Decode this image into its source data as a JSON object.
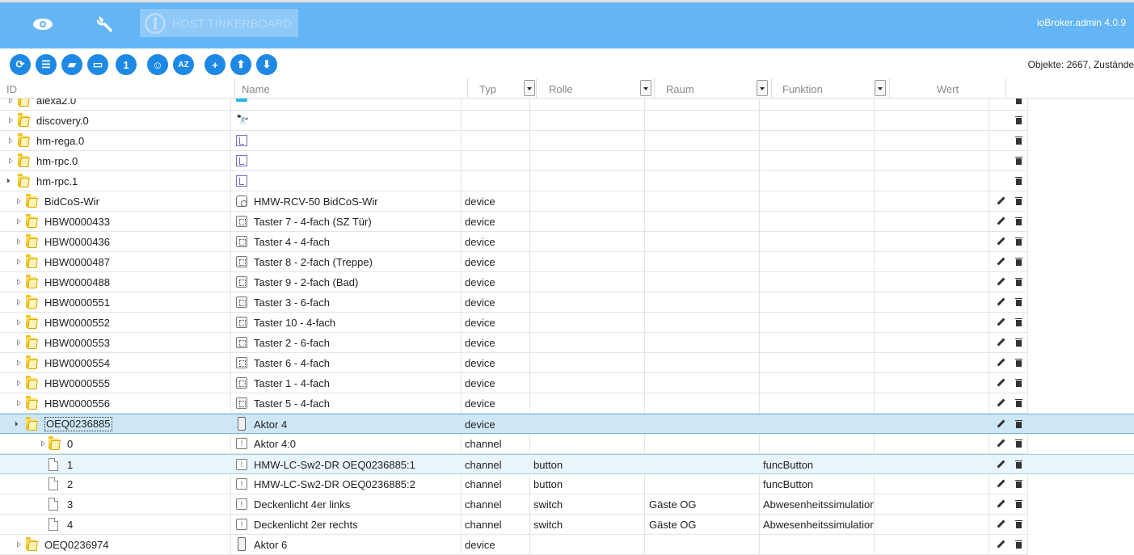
{
  "topbar": {
    "icons": [
      "eye-icon",
      "wrench-icon"
    ],
    "host_label": "HOST TINKERBOARD",
    "version": "ioBroker.admin 4.0.9",
    "accent_color": "#64b5f6"
  },
  "toolbar": {
    "buttons": [
      {
        "icon": "refresh-icon",
        "glyph": "⟳"
      },
      {
        "icon": "list-view-icon",
        "glyph": "☰"
      },
      {
        "icon": "folder-closed-icon",
        "glyph": "▰"
      },
      {
        "icon": "folder-open-icon",
        "glyph": "▭"
      },
      {
        "icon": "number-one-icon",
        "glyph": "1"
      },
      {
        "icon": "user-settings-icon",
        "glyph": "☺"
      },
      {
        "icon": "sort-az-icon",
        "glyph": "AZ"
      },
      {
        "icon": "add-icon",
        "glyph": "+"
      },
      {
        "icon": "upload-icon",
        "glyph": "⬆"
      },
      {
        "icon": "download-icon",
        "glyph": "⬇"
      }
    ],
    "counts": "Objekte: 2667, Zustände"
  },
  "columns": {
    "id": "ID",
    "name": "Name",
    "typ": "Typ",
    "rolle": "Rolle",
    "raum": "Raum",
    "funktion": "Funktion",
    "wert": "Wert"
  },
  "rows": [
    {
      "id": "alexa2.0",
      "name": "",
      "typ": "",
      "rolle": "",
      "raum": "",
      "funktion": "",
      "level": 0,
      "kind": "folder",
      "expander": "closed",
      "icon": "alexa-icon",
      "edit": false
    },
    {
      "id": "discovery.0",
      "name": "",
      "typ": "",
      "rolle": "",
      "raum": "",
      "funktion": "",
      "level": 0,
      "kind": "folder",
      "expander": "closed",
      "icon": "binoculars-icon",
      "edit": false
    },
    {
      "id": "hm-rega.0",
      "name": "",
      "typ": "",
      "rolle": "",
      "raum": "",
      "funktion": "",
      "level": 0,
      "kind": "folder",
      "expander": "closed",
      "icon": "homematic-icon",
      "edit": false
    },
    {
      "id": "hm-rpc.0",
      "name": "",
      "typ": "",
      "rolle": "",
      "raum": "",
      "funktion": "",
      "level": 0,
      "kind": "folder",
      "expander": "closed",
      "icon": "homematic-icon",
      "edit": false
    },
    {
      "id": "hm-rpc.1",
      "name": "",
      "typ": "",
      "rolle": "",
      "raum": "",
      "funktion": "",
      "level": 0,
      "kind": "folder",
      "expander": "open",
      "icon": "homematic-icon",
      "edit": false
    },
    {
      "id": "BidCoS-Wir",
      "name": "HMW-RCV-50 BidCoS-Wir",
      "typ": "device",
      "rolle": "",
      "raum": "",
      "funktion": "",
      "level": 1,
      "kind": "folder",
      "expander": "closed",
      "icon": "bidcos-device-icon",
      "edit": true
    },
    {
      "id": "HBW0000433",
      "name": "Taster 7 - 4-fach (SZ Tür)",
      "typ": "device",
      "rolle": "",
      "raum": "",
      "funktion": "",
      "level": 1,
      "kind": "folder",
      "expander": "closed",
      "icon": "button-device-icon",
      "edit": true
    },
    {
      "id": "HBW0000436",
      "name": "Taster 4 - 4-fach",
      "typ": "device",
      "rolle": "",
      "raum": "",
      "funktion": "",
      "level": 1,
      "kind": "folder",
      "expander": "closed",
      "icon": "button-device-icon",
      "edit": true
    },
    {
      "id": "HBW0000487",
      "name": "Taster 8 - 2-fach (Treppe)",
      "typ": "device",
      "rolle": "",
      "raum": "",
      "funktion": "",
      "level": 1,
      "kind": "folder",
      "expander": "closed",
      "icon": "button-device-icon",
      "edit": true
    },
    {
      "id": "HBW0000488",
      "name": "Taster 9 - 2-fach (Bad)",
      "typ": "device",
      "rolle": "",
      "raum": "",
      "funktion": "",
      "level": 1,
      "kind": "folder",
      "expander": "closed",
      "icon": "button-device-icon",
      "edit": true
    },
    {
      "id": "HBW0000551",
      "name": "Taster 3 - 6-fach",
      "typ": "device",
      "rolle": "",
      "raum": "",
      "funktion": "",
      "level": 1,
      "kind": "folder",
      "expander": "closed",
      "icon": "button-device-icon",
      "edit": true
    },
    {
      "id": "HBW0000552",
      "name": "Taster 10 - 4-fach",
      "typ": "device",
      "rolle": "",
      "raum": "",
      "funktion": "",
      "level": 1,
      "kind": "folder",
      "expander": "closed",
      "icon": "button-device-icon",
      "edit": true
    },
    {
      "id": "HBW0000553",
      "name": "Taster 2 - 6-fach",
      "typ": "device",
      "rolle": "",
      "raum": "",
      "funktion": "",
      "level": 1,
      "kind": "folder",
      "expander": "closed",
      "icon": "button-device-icon",
      "edit": true
    },
    {
      "id": "HBW0000554",
      "name": "Taster 6 - 4-fach",
      "typ": "device",
      "rolle": "",
      "raum": "",
      "funktion": "",
      "level": 1,
      "kind": "folder",
      "expander": "closed",
      "icon": "button-device-icon",
      "edit": true
    },
    {
      "id": "HBW0000555",
      "name": "Taster 1 - 4-fach",
      "typ": "device",
      "rolle": "",
      "raum": "",
      "funktion": "",
      "level": 1,
      "kind": "folder",
      "expander": "closed",
      "icon": "button-device-icon",
      "edit": true
    },
    {
      "id": "HBW0000556",
      "name": "Taster 5 - 4-fach",
      "typ": "device",
      "rolle": "",
      "raum": "",
      "funktion": "",
      "level": 1,
      "kind": "folder",
      "expander": "closed",
      "icon": "button-device-icon",
      "edit": true
    },
    {
      "id": "OEQ0236885",
      "name": "Aktor 4",
      "typ": "device",
      "rolle": "",
      "raum": "",
      "funktion": "",
      "level": 1,
      "kind": "folder",
      "expander": "open",
      "icon": "actuator-device-icon",
      "edit": true,
      "state": "selected"
    },
    {
      "id": "0",
      "name": "Aktor 4:0",
      "typ": "channel",
      "rolle": "",
      "raum": "",
      "funktion": "",
      "level": 2,
      "kind": "folder",
      "expander": "closed",
      "icon": "channel-icon",
      "edit": true
    },
    {
      "id": "1",
      "name": "HMW-LC-Sw2-DR OEQ0236885:1",
      "typ": "channel",
      "rolle": "button",
      "raum": "",
      "funktion": "funcButton",
      "level": 2,
      "kind": "file",
      "expander": "none",
      "icon": "channel-icon",
      "edit": true,
      "state": "hover"
    },
    {
      "id": "2",
      "name": "HMW-LC-Sw2-DR OEQ0236885:2",
      "typ": "channel",
      "rolle": "button",
      "raum": "",
      "funktion": "funcButton",
      "level": 2,
      "kind": "file",
      "expander": "none",
      "icon": "channel-icon",
      "edit": true
    },
    {
      "id": "3",
      "name": "Deckenlicht 4er links",
      "typ": "channel",
      "rolle": "switch",
      "raum": "Gäste OG",
      "funktion": "Abwesenheitssimulation",
      "level": 2,
      "kind": "file",
      "expander": "none",
      "icon": "channel-icon",
      "edit": true
    },
    {
      "id": "4",
      "name": "Deckenlicht 2er rechts",
      "typ": "channel",
      "rolle": "switch",
      "raum": "Gäste OG",
      "funktion": "Abwesenheitssimulation",
      "level": 2,
      "kind": "file",
      "expander": "none",
      "icon": "channel-icon",
      "edit": true
    },
    {
      "id": "OEQ0236974",
      "name": "Aktor 6",
      "typ": "device",
      "rolle": "",
      "raum": "",
      "funktion": "",
      "level": 1,
      "kind": "folder",
      "expander": "closed",
      "icon": "actuator-device-icon",
      "edit": true
    }
  ]
}
